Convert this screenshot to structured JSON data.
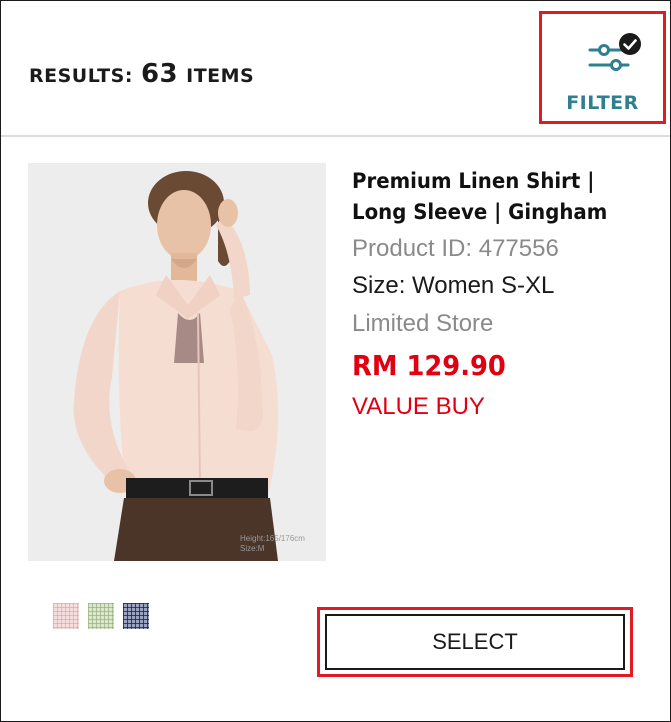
{
  "header": {
    "results_label": "RESULTS:",
    "results_count": "63",
    "results_unit": "ITEMS",
    "filter_label": "FILTER",
    "filter_active": true,
    "filter_icon": "sliders-icon",
    "active_badge_icon": "check-badge-icon"
  },
  "product": {
    "title": "Premium Linen Shirt | Long Sleeve | Gingham",
    "product_id": "Product ID: 477556",
    "size": "Size: Women S-XL",
    "availability": "Limited Store",
    "price": "RM 129.90",
    "badge": "VALUE BUY",
    "image_caption": "Height:165/176cm Size:M",
    "swatches": [
      {
        "name": "pink gingham",
        "color": "#f7dede"
      },
      {
        "name": "green gingham",
        "color": "#dbe6cf"
      },
      {
        "name": "navy gingham",
        "color": "#2d3564"
      }
    ],
    "select_label": "SELECT"
  },
  "colors": {
    "accent_teal": "#2f7f91",
    "price_red": "#e10012",
    "highlight_red": "#e01b24"
  }
}
